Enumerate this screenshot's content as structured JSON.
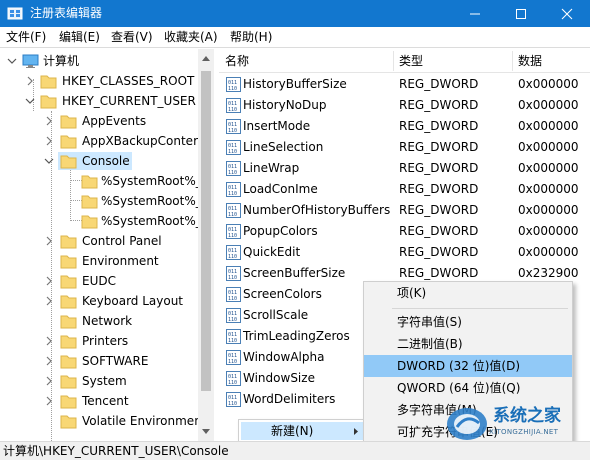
{
  "window": {
    "title": "注册表编辑器",
    "accent": "#1277cf"
  },
  "menu": [
    "文件(F)",
    "编辑(E)",
    "查看(V)",
    "收藏夹(A)",
    "帮助(H)"
  ],
  "tree": {
    "root": "计算机",
    "classes_root": "HKEY_CLASSES_ROOT",
    "current_user": "HKEY_CURRENT_USER",
    "items": [
      "AppEvents",
      "AppXBackupConter",
      "Console",
      "%SystemRoot%_",
      "%SystemRoot%_",
      "%SystemRoot%_",
      "Control Panel",
      "Environment",
      "EUDC",
      "Keyboard Layout",
      "Network",
      "Printers",
      "SOFTWARE",
      "System",
      "Tencent",
      "Volatile Environmen"
    ],
    "selected": "Console"
  },
  "list": {
    "columns": [
      "名称",
      "类型",
      "数据"
    ],
    "rows": [
      {
        "name": "HistoryBufferSize",
        "type": "REG_DWORD",
        "data": "0x000000"
      },
      {
        "name": "HistoryNoDup",
        "type": "REG_DWORD",
        "data": "0x000000"
      },
      {
        "name": "InsertMode",
        "type": "REG_DWORD",
        "data": "0x000000"
      },
      {
        "name": "LineSelection",
        "type": "REG_DWORD",
        "data": "0x000000"
      },
      {
        "name": "LineWrap",
        "type": "REG_DWORD",
        "data": "0x000000"
      },
      {
        "name": "LoadConIme",
        "type": "REG_DWORD",
        "data": "0x000000"
      },
      {
        "name": "NumberOfHistoryBuffers",
        "type": "REG_DWORD",
        "data": "0x000000"
      },
      {
        "name": "PopupColors",
        "type": "REG_DWORD",
        "data": "0x000000"
      },
      {
        "name": "QuickEdit",
        "type": "REG_DWORD",
        "data": "0x000000"
      },
      {
        "name": "ScreenBufferSize",
        "type": "REG_DWORD",
        "data": "0x232900"
      },
      {
        "name": "ScreenColors",
        "type": "",
        "data": ""
      },
      {
        "name": "ScrollScale",
        "type": "",
        "data": ""
      },
      {
        "name": "TrimLeadingZeros",
        "type": "",
        "data": ""
      },
      {
        "name": "WindowAlpha",
        "type": "",
        "data": ""
      },
      {
        "name": "WindowSize",
        "type": "",
        "data": ""
      },
      {
        "name": "WordDelimiters",
        "type": "",
        "data": ""
      }
    ]
  },
  "context_menu": {
    "new_label": "新建(N)",
    "submenu": [
      "项(K)",
      "字符串值(S)",
      "二进制值(B)",
      "DWORD (32 位)值(D)",
      "QWORD (64 位)值(Q)",
      "多字符串值(M)",
      "可扩充字符串值(E)"
    ],
    "highlighted": "DWORD (32 位)值(D)",
    "highlight_color": "#91c9f7"
  },
  "status": {
    "path": "计算机\\HKEY_CURRENT_USER\\Console"
  },
  "watermark": {
    "text": "系统之家",
    "url": "XITONGZHIJIA.NET"
  }
}
